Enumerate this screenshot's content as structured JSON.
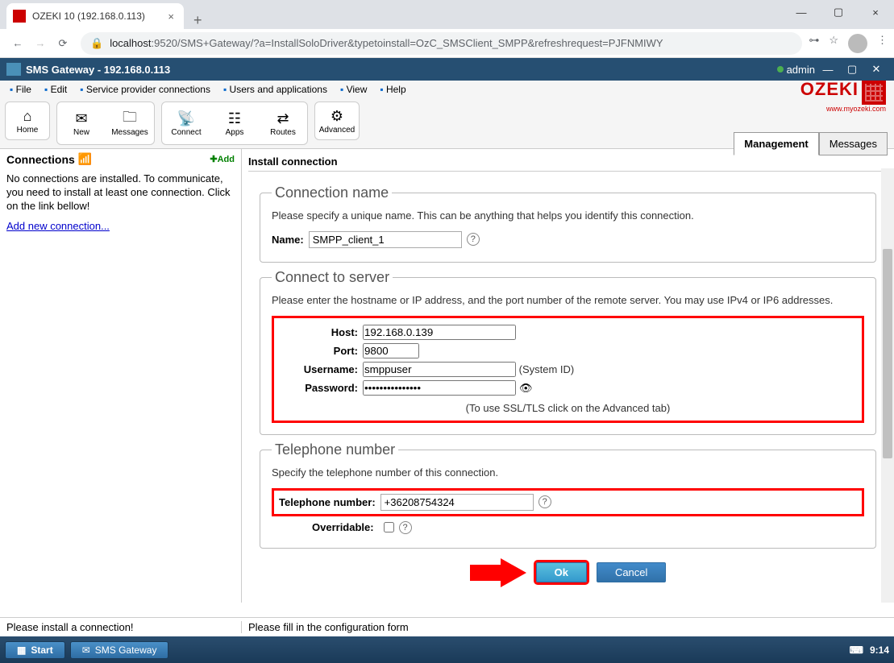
{
  "browser": {
    "tab_title": "OZEKI 10 (192.168.0.113)",
    "url_prefix": "localhost",
    "url_rest": ":9520/SMS+Gateway/?a=InstallSoloDriver&typetoinstall=OzC_SMSClient_SMPP&refreshrequest=PJFNMIWY"
  },
  "app": {
    "title": "SMS Gateway - 192.168.0.113",
    "user": "admin"
  },
  "menu": [
    "File",
    "Edit",
    "Service provider connections",
    "Users and applications",
    "View",
    "Help"
  ],
  "logo": {
    "brand": "OZEKI",
    "sub": "www.myozeki.com"
  },
  "toolbar": {
    "home": "Home",
    "new": "New",
    "messages": "Messages",
    "connect": "Connect",
    "apps": "Apps",
    "routes": "Routes",
    "advanced": "Advanced"
  },
  "tabs": {
    "management": "Management",
    "messages": "Messages"
  },
  "sidebar": {
    "title": "Connections",
    "add": "Add",
    "text": "No connections are installed. To communicate, you need to install at least one connection. Click on the link bellow!",
    "link": "Add new connection..."
  },
  "content": {
    "title": "Install connection",
    "conn_name": {
      "legend": "Connection name",
      "desc": "Please specify a unique name. This can be anything that helps you identify this connection.",
      "label": "Name:",
      "value": "SMPP_client_1"
    },
    "server": {
      "legend": "Connect to server",
      "desc": "Please enter the hostname or IP address, and the port number of the remote server. You may use IPv4 or IP6 addresses.",
      "host_label": "Host:",
      "host": "192.168.0.139",
      "port_label": "Port:",
      "port": "9800",
      "user_label": "Username:",
      "user": "smppuser",
      "user_hint": "(System ID)",
      "pass_label": "Password:",
      "pass": "•••••••••••••••",
      "ssl_hint": "(To use SSL/TLS click on the Advanced tab)"
    },
    "tel": {
      "legend": "Telephone number",
      "desc": "Specify the telephone number of this connection.",
      "label": "Telephone number:",
      "value": "+36208754324",
      "overridable": "Overridable:"
    },
    "ok": "Ok",
    "cancel": "Cancel"
  },
  "status": {
    "left": "Please install a connection!",
    "right": "Please fill in the configuration form"
  },
  "taskbar": {
    "start": "Start",
    "sms": "SMS Gateway",
    "time": "9:14"
  }
}
